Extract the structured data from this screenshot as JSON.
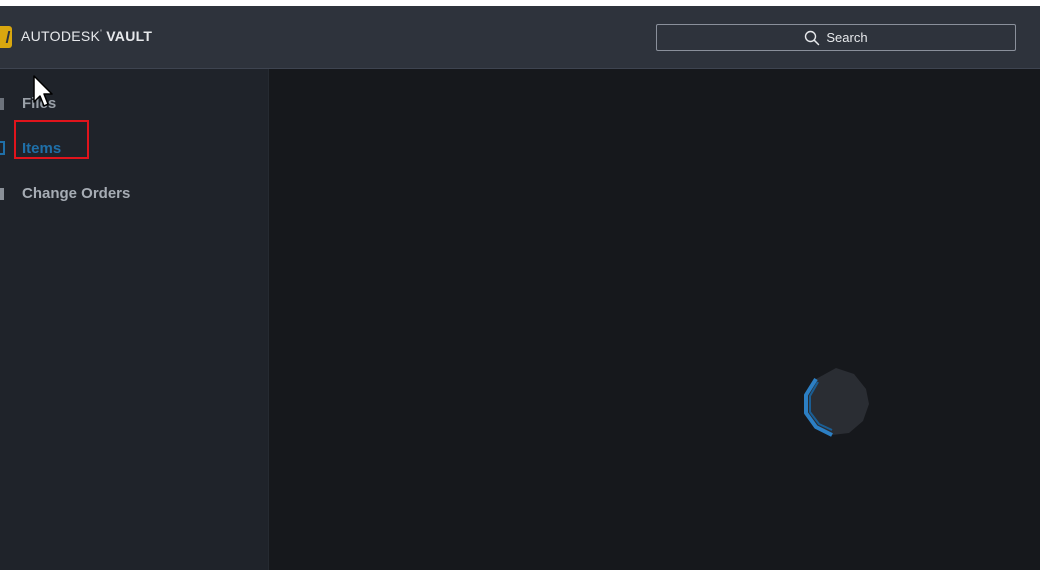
{
  "header": {
    "logo_brand": "AUTODESK",
    "logo_product": "VAULT",
    "logo_mark": "V",
    "search_label": "Search",
    "search_icon": "search-icon"
  },
  "sidebar": {
    "items": [
      {
        "label": "Files",
        "icon": "files-icon",
        "state": "normal"
      },
      {
        "label": "Items",
        "icon": "items-icon",
        "state": "selected"
      },
      {
        "label": "Change Orders",
        "icon": "change-orders-icon",
        "state": "normal"
      }
    ]
  },
  "main": {
    "status": "loading",
    "spinner_icon": "loading-spinner-icon"
  },
  "colors": {
    "header_bg": "#2e333c",
    "sidebar_bg": "#1f232a",
    "main_bg": "#16181c",
    "accent": "#1f6fa8",
    "logo_yellow": "#d9a70f",
    "highlight": "#e0141c"
  }
}
